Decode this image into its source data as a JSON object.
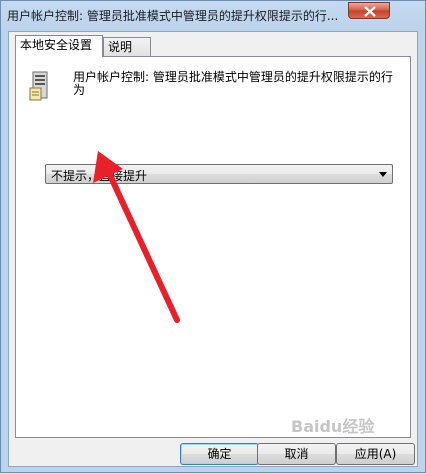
{
  "window": {
    "title": "用户帐户控制: 管理员批准模式中管理员的提升权限提示的行..."
  },
  "tabs": [
    {
      "label": "本地安全设置",
      "active": true
    },
    {
      "label": "说明",
      "active": false
    }
  ],
  "policy": {
    "icon": "server-policy-icon",
    "description": "用户帐户控制: 管理员批准模式中管理员的提升权限提示的行为"
  },
  "dropdown": {
    "selected": "不提示，直接提升"
  },
  "annotation": {
    "color": "#e8202a"
  },
  "buttons": {
    "ok": "确定",
    "cancel": "取消",
    "apply": "应用(A)"
  },
  "watermark": "Baidu经验"
}
